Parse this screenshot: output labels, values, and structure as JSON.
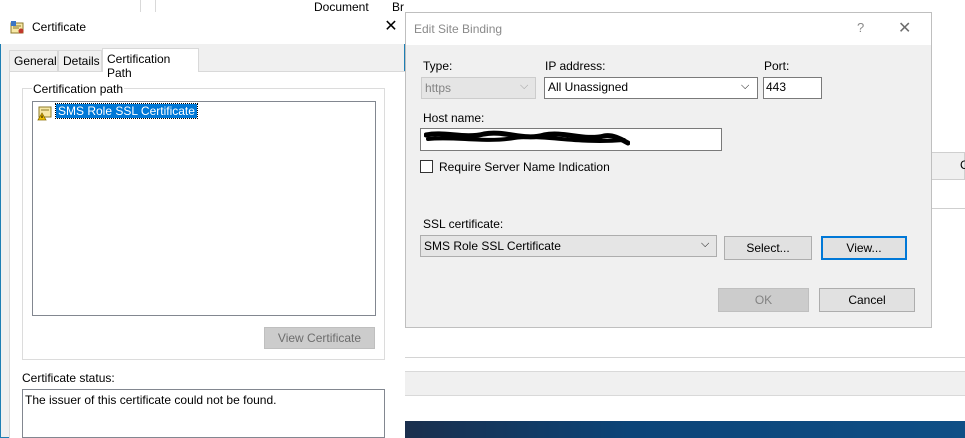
{
  "background": {
    "document_column": "Document",
    "browse_column": "Br",
    "right_edge_letter": "C"
  },
  "cert_window": {
    "title": "Certificate",
    "close_glyph": "✕",
    "tabs": [
      {
        "label": "General"
      },
      {
        "label": "Details"
      },
      {
        "label": "Certification Path"
      }
    ],
    "path_group_label": "Certification path",
    "tree_item": "SMS Role SSL Certificate",
    "view_cert_button": "View Certificate",
    "status_label": "Certificate status:",
    "status_text": "The issuer of this certificate could not be found."
  },
  "binding_dialog": {
    "title": "Edit Site Binding",
    "help_glyph": "?",
    "close_glyph": "✕",
    "type_label": "Type:",
    "type_value": "https",
    "ip_label": "IP address:",
    "ip_value": "All Unassigned",
    "port_label": "Port:",
    "port_value": "443",
    "host_label": "Host name:",
    "sni_label": "Require Server Name Indication",
    "sni_checked": false,
    "ssl_label": "SSL certificate:",
    "ssl_value": "SMS Role SSL Certificate",
    "select_button": "Select...",
    "view_button": "View...",
    "ok_button": "OK",
    "cancel_button": "Cancel",
    "chevron_glyph": "⌵"
  },
  "colors": {
    "selection": "#0078d7",
    "window_border": "#1e7fb4",
    "dialog_bg": "#f0f0f0"
  }
}
